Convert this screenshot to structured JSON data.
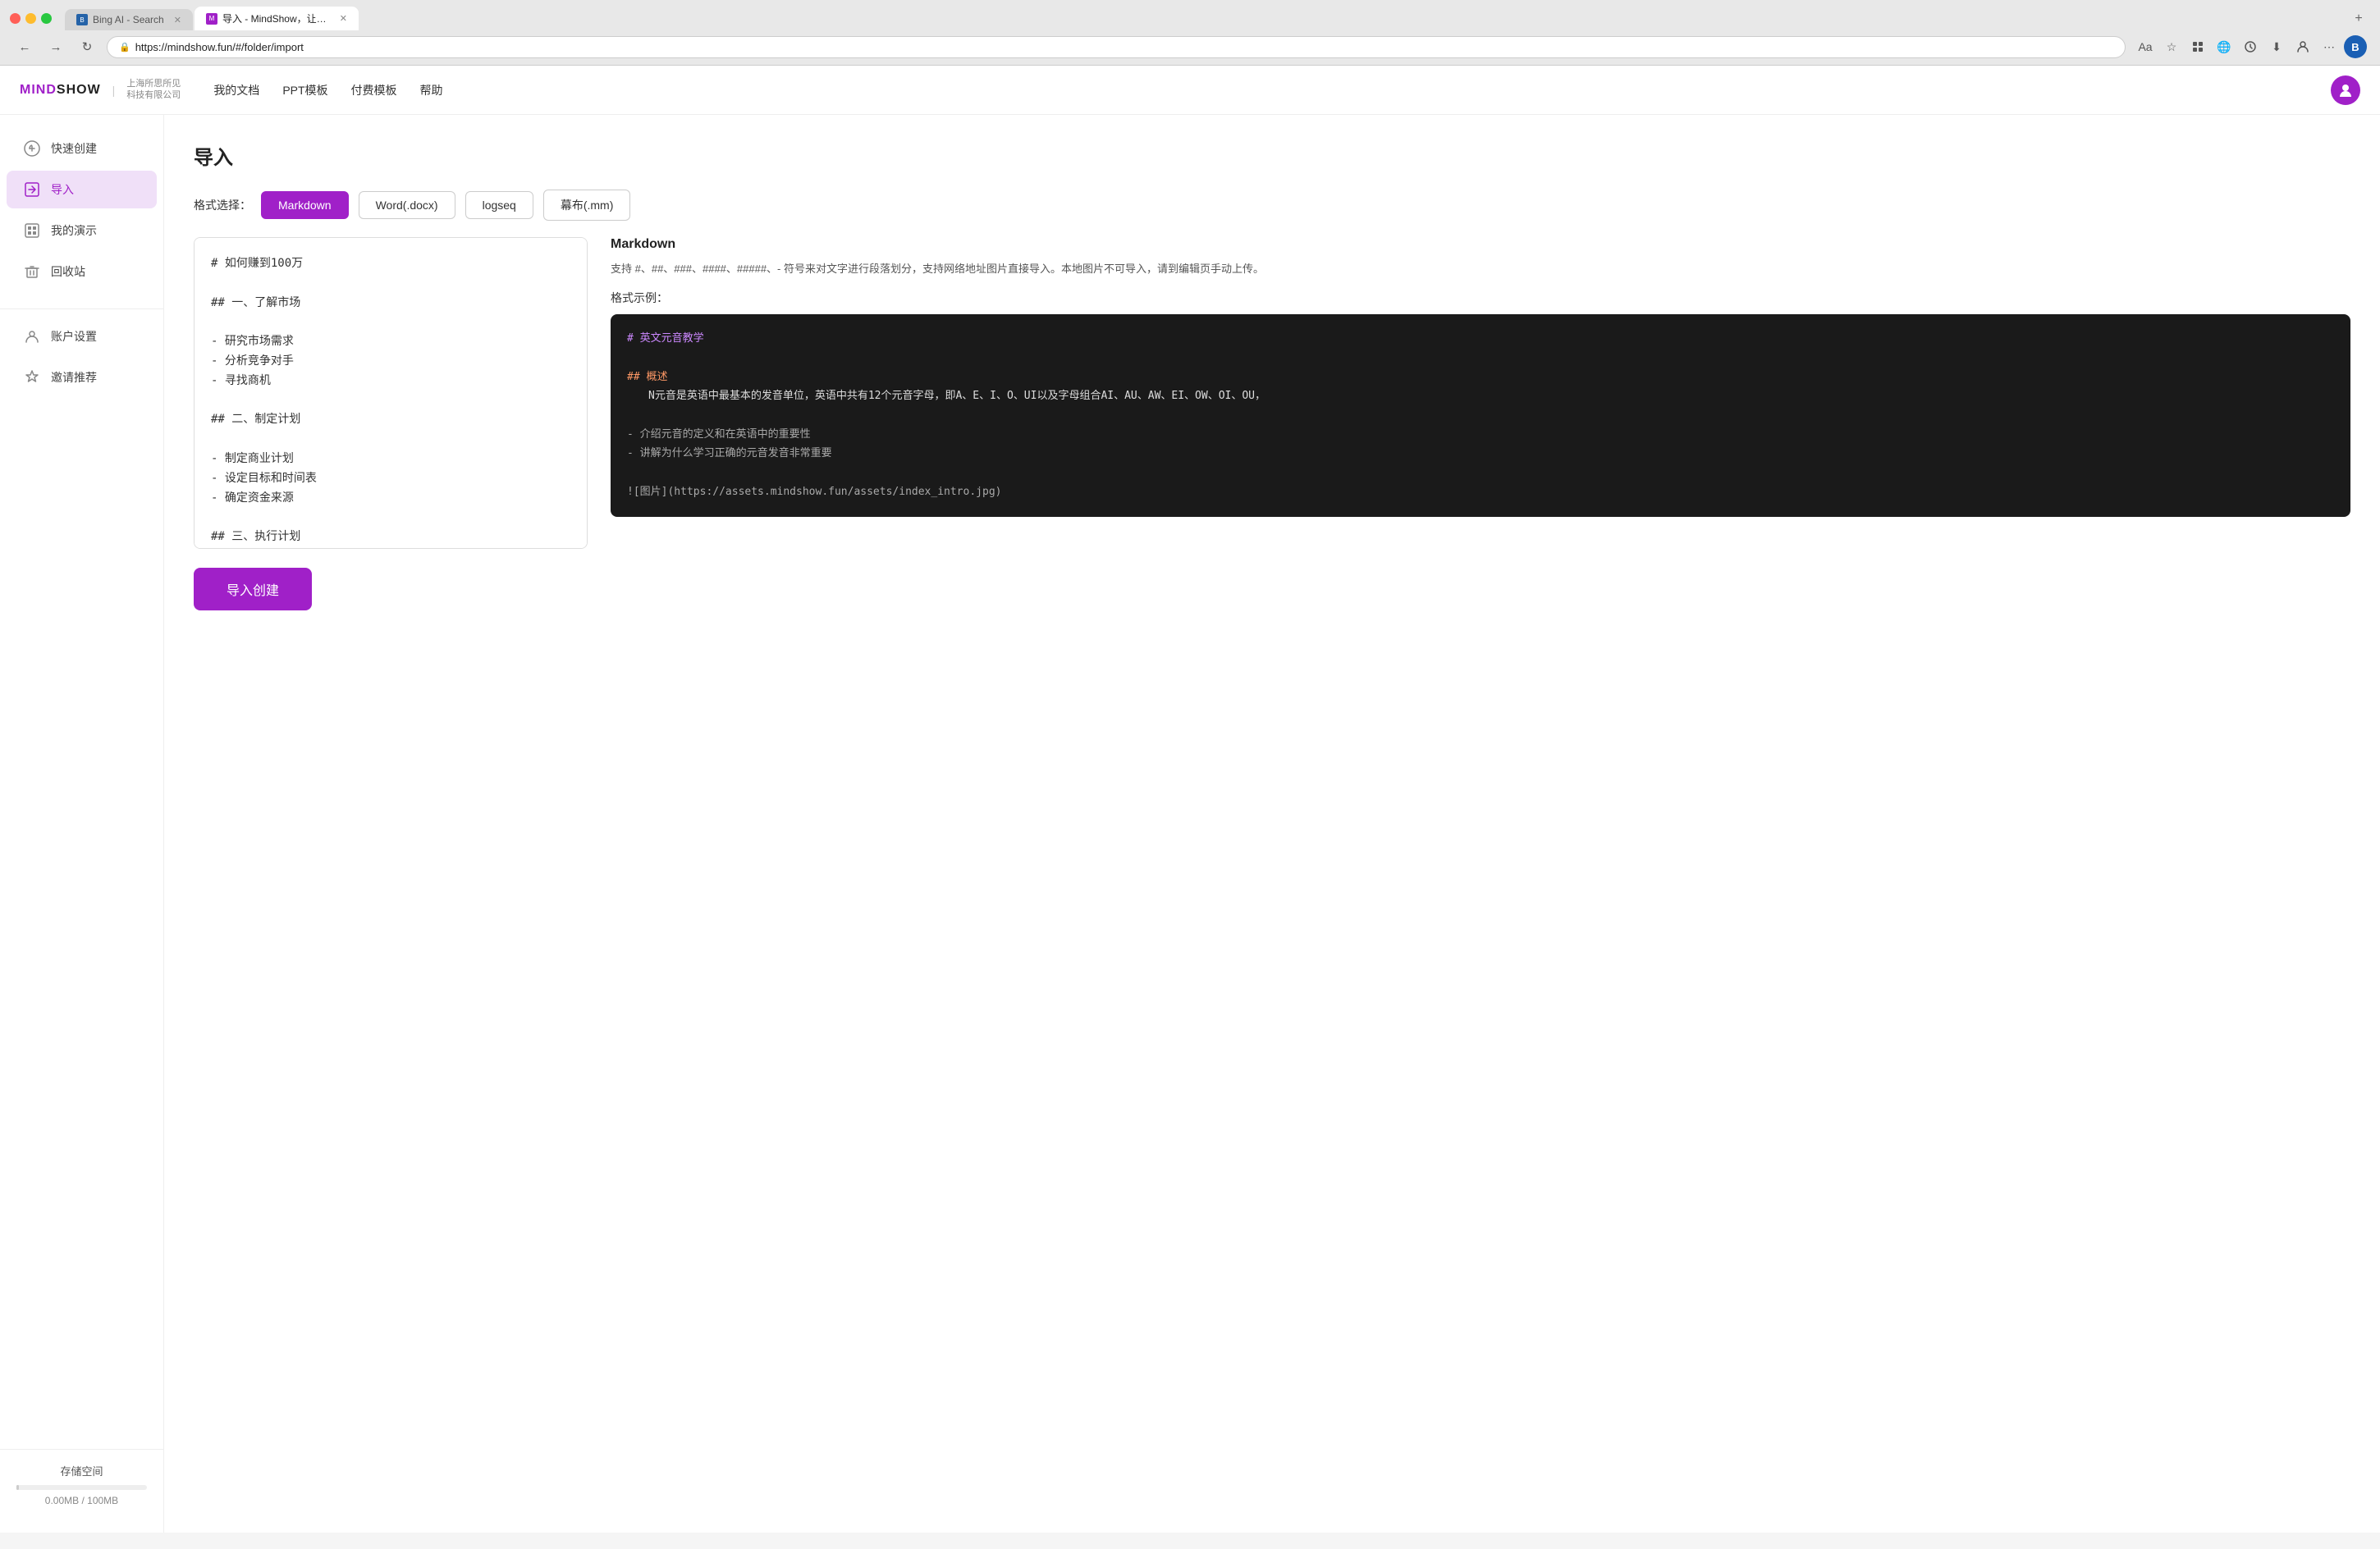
{
  "browser": {
    "tabs": [
      {
        "id": "tab-bing",
        "label": "Bing AI - Search",
        "favicon_type": "bing",
        "favicon_text": "B",
        "active": false
      },
      {
        "id": "tab-mindshow",
        "label": "导入 - MindShow，让想法快速...",
        "favicon_type": "mindshow",
        "favicon_text": "M",
        "active": true
      }
    ],
    "url": "https://mindshow.fun/#/folder/import",
    "add_tab_label": "+",
    "nav": {
      "back": "←",
      "forward": "→",
      "refresh": "↻"
    },
    "toolbar_icons": [
      "Aa",
      "☆",
      "⊕",
      "🌐",
      "↻",
      "⬇",
      "👤",
      "⋯",
      "B"
    ]
  },
  "app": {
    "logo": "MINDSHOW",
    "logo_divider": "|",
    "logo_sub_line1": "上海所思所见",
    "logo_sub_line2": "科技有限公司",
    "nav_items": [
      "我的文档",
      "PPT模板",
      "付费模板",
      "帮助"
    ]
  },
  "sidebar": {
    "items": [
      {
        "id": "quick-create",
        "label": "快速创建",
        "icon": "✦",
        "active": false
      },
      {
        "id": "import",
        "label": "导入",
        "icon": "⬆",
        "active": true
      },
      {
        "id": "my-presentations",
        "label": "我的演示",
        "icon": "▦",
        "active": false
      },
      {
        "id": "trash",
        "label": "回收站",
        "icon": "🗑",
        "active": false
      },
      {
        "id": "account-settings",
        "label": "账户设置",
        "icon": "👤",
        "active": false
      },
      {
        "id": "invite-recommend",
        "label": "邀请推荐",
        "icon": "🏆",
        "active": false
      }
    ],
    "storage": {
      "label": "存储空间",
      "used": "0.00MB",
      "total": "100MB",
      "display": "0.00MB / 100MB",
      "percent": 0
    }
  },
  "main": {
    "page_title": "导入",
    "format_label": "格式选择：",
    "formats": [
      {
        "id": "markdown",
        "label": "Markdown",
        "active": true
      },
      {
        "id": "word",
        "label": "Word(.docx)",
        "active": false
      },
      {
        "id": "logseq",
        "label": "logseq",
        "active": false
      },
      {
        "id": "mubu",
        "label": "幕布(.mm)",
        "active": false
      }
    ],
    "editor": {
      "content": "# 如何赚到100万\n\n## 一、了解市场\n\n- 研究市场需求\n- 分析竞争对手\n- 寻找商机\n\n## 二、制定计划\n\n- 制定商业计划\n- 设定目标和时间表\n- 确定资金来源\n\n## 三、执行计划\n\n- 建立团队\n- 推广产品或服务"
    },
    "info": {
      "title": "Markdown",
      "description": "支持 #、##、###、####、#####、- 符号来对文字进行段落划分，支持网络地址图片直接导入。本地图片不可导入，请到编辑页手动上传。",
      "example_label": "格式示例：",
      "example_lines": [
        {
          "type": "h1",
          "text": "# 英文元音教学"
        },
        {
          "type": "blank",
          "text": ""
        },
        {
          "type": "h2",
          "text": "## 概述"
        },
        {
          "type": "body",
          "text": "   N元音是英语中最基本的发音单位，英语中共有12个元音字母，即A、E、I、O、UI以及字母组合AI、AU、AW、EI、OW、OI、OU，"
        },
        {
          "type": "blank",
          "text": ""
        },
        {
          "type": "bullet",
          "text": "- 介绍元音的定义和在英语中的重要性"
        },
        {
          "type": "bullet",
          "text": "- 讲解为什么学习正确的元音发音非常重要"
        },
        {
          "type": "blank",
          "text": ""
        },
        {
          "type": "image",
          "text": "![图片](https://assets.mindshow.fun/assets/index_intro.jpg)"
        }
      ]
    },
    "import_btn_label": "导入创建"
  }
}
